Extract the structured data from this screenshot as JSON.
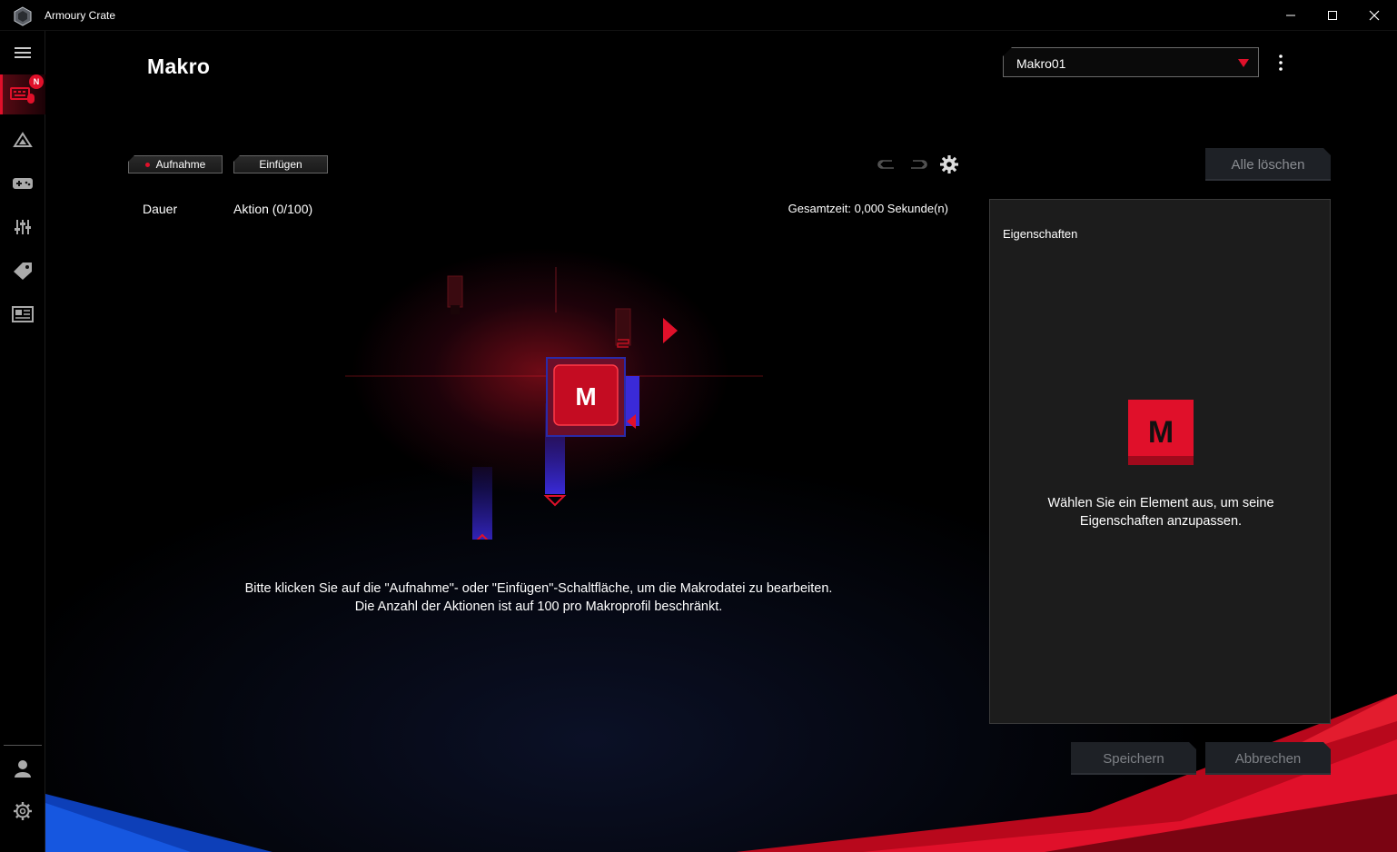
{
  "window": {
    "title": "Armoury Crate",
    "icons": [
      "app-logo-icon",
      "minimize-icon",
      "maximize-icon",
      "close-icon"
    ]
  },
  "sidebar": {
    "items": [
      {
        "name": "menu-icon"
      },
      {
        "name": "keyboard-mouse-icon",
        "active": true,
        "badge": "N"
      },
      {
        "name": "aura-triangle-icon"
      },
      {
        "name": "gamepad-icon"
      },
      {
        "name": "sliders-icon"
      },
      {
        "name": "tag-icon"
      },
      {
        "name": "news-icon"
      },
      {
        "name": "user-icon"
      },
      {
        "name": "settings-icon"
      }
    ]
  },
  "header": {
    "title": "Makro",
    "profile_select": {
      "value": "Makro01"
    }
  },
  "toolbar": {
    "record_label": "Aufnahme",
    "insert_label": "Einfügen",
    "clear_all_label": "Alle löschen"
  },
  "list": {
    "col_duration": "Dauer",
    "col_action": "Aktion (0/100)",
    "total_time": "Gesamtzeit: 0,000 Sekunde(n)",
    "empty_hint_line1": "Bitte klicken Sie auf die \"Aufnahme\"- oder \"Einfügen\"-Schaltfläche, um die Makrodatei zu bearbeiten.",
    "empty_hint_line2": "Die Anzahl der Aktionen ist auf 100 pro Makroprofil beschränkt.",
    "illustration_key": "M"
  },
  "properties": {
    "title": "Eigenschaften",
    "icon_letter": "M",
    "message": "Wählen Sie ein Element aus, um seine Eigenschaften anzupassen."
  },
  "footer": {
    "save_label": "Speichern",
    "cancel_label": "Abbrechen"
  },
  "colors": {
    "accent": "#e0102a",
    "panel": "#1c1c1c",
    "disabled_button": "#1e2126"
  }
}
